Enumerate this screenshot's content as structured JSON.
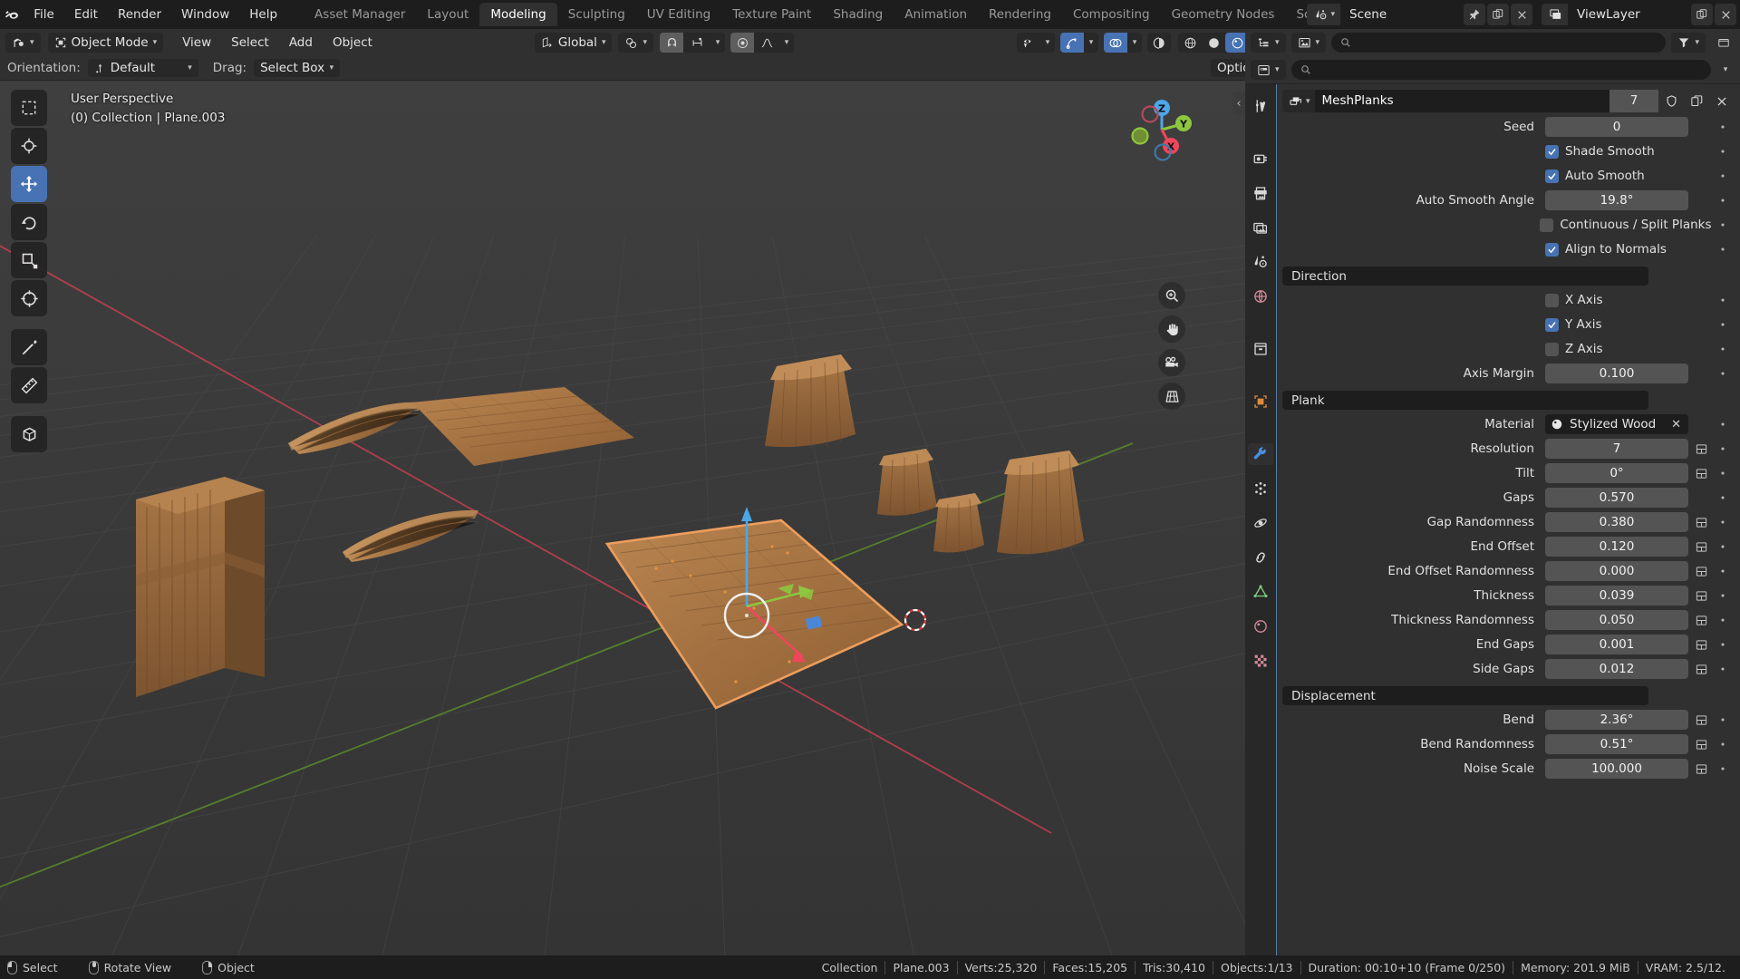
{
  "app": {
    "name": "Blender",
    "logo_icon": "blender-logo-icon"
  },
  "topbar": {
    "menus": [
      "File",
      "Edit",
      "Render",
      "Window",
      "Help"
    ],
    "workspace_tabs": [
      {
        "label": "Asset Manager",
        "active": false
      },
      {
        "label": "Layout",
        "active": false
      },
      {
        "label": "Modeling",
        "active": true
      },
      {
        "label": "Sculpting",
        "active": false
      },
      {
        "label": "UV Editing",
        "active": false
      },
      {
        "label": "Texture Paint",
        "active": false
      },
      {
        "label": "Shading",
        "active": false
      },
      {
        "label": "Animation",
        "active": false
      },
      {
        "label": "Rendering",
        "active": false
      },
      {
        "label": "Compositing",
        "active": false
      },
      {
        "label": "Geometry Nodes",
        "active": false
      },
      {
        "label": "Sc",
        "active": false
      }
    ],
    "scene": {
      "icon": "scene-icon",
      "name": "Scene",
      "pin_icon": "pin-icon",
      "new_icon": "new-scene-icon",
      "delete_icon": "close-icon"
    },
    "viewlayer": {
      "icon": "view-layer-icon",
      "name": "ViewLayer",
      "new_icon": "new-viewlayer-icon",
      "delete_icon": "close-icon"
    }
  },
  "viewport_header": {
    "editor_type_icon": "editor-type-3dview-icon",
    "mode": "Object Mode",
    "mode_icon": "object-mode-icon",
    "menus": [
      "View",
      "Select",
      "Add",
      "Object"
    ],
    "transform_orientation": {
      "label": "Global",
      "icon": "orientation-icon"
    },
    "pivot_icon": "pivot-point-icon",
    "snap_magnet_icon": "snap-magnet-icon",
    "snap_target_icon": "snap-increment-icon",
    "proportional_icon": "proportional-editing-icon",
    "falloff_icon": "falloff-smooth-icon",
    "visibility_icon": "object-visibility-icon",
    "gizmo_icon": "gizmo-icon",
    "overlays_icon": "overlays-icon",
    "xray_icon": "xray-icon",
    "shading_modes": [
      "wireframe",
      "solid",
      "material-preview",
      "rendered"
    ],
    "shading_active": "material-preview"
  },
  "tool_settings": {
    "orientation_label": "Orientation:",
    "orientation_value": "Default",
    "orientation_icon": "orientation-default-icon",
    "drag_label": "Drag:",
    "drag_value": "Select Box",
    "options_label": "Options"
  },
  "viewport": {
    "perspective_label": "User Perspective",
    "object_label": "(0) Collection | Plane.003",
    "gizmo_axes": [
      {
        "axis": "Z",
        "color": "#4ba7e8",
        "label": "Z"
      },
      {
        "axis": "Y",
        "color": "#8dc63f",
        "label": "Y"
      },
      {
        "axis": "X",
        "color": "#f0465c",
        "label": "X"
      }
    ],
    "nav_buttons": [
      "zoom-icon",
      "pan-hand-icon",
      "camera-icon",
      "orthographic-grid-icon"
    ],
    "sidebar_toggle_icon": "chevron-left-icon",
    "tools": [
      {
        "name": "tweak-select-box-tool",
        "icon": "select-box-icon",
        "active": false
      },
      {
        "name": "cursor-tool",
        "icon": "cursor-3d-icon",
        "active": false
      },
      {
        "name": "move-tool",
        "icon": "move-arrows-icon",
        "active": true
      },
      {
        "name": "rotate-tool",
        "icon": "rotate-icon",
        "active": false
      },
      {
        "name": "scale-tool",
        "icon": "scale-icon",
        "active": false
      },
      {
        "name": "transform-tool",
        "icon": "transform-icon",
        "active": false
      },
      {
        "name": "annotate-tool",
        "icon": "pencil-icon",
        "active": false
      },
      {
        "name": "measure-tool",
        "icon": "ruler-icon",
        "active": false
      },
      {
        "name": "add-cube-tool",
        "icon": "add-cube-icon",
        "active": false
      }
    ]
  },
  "properties": {
    "editor_icon": "properties-editor-icon",
    "outliner_icon": "outliner-icon",
    "filter_icon": "filter-icon",
    "search_placeholder": "",
    "tabs": [
      {
        "name": "tool-tab",
        "icon": "tool-wrench-screwdriver-icon",
        "active": false
      },
      {
        "name": "render-tab",
        "icon": "render-camera-back-icon",
        "active": false
      },
      {
        "name": "output-tab",
        "icon": "output-printer-icon",
        "active": false
      },
      {
        "name": "view-layer-tab",
        "icon": "view-layer-images-icon",
        "active": false
      },
      {
        "name": "scene-tab",
        "icon": "scene-cone-sphere-icon",
        "active": false
      },
      {
        "name": "world-tab",
        "icon": "world-globe-icon",
        "active": false
      },
      {
        "name": "collection-tab",
        "icon": "collection-box-icon",
        "active": false
      },
      {
        "name": "object-tab",
        "icon": "object-square-icon",
        "active": false
      },
      {
        "name": "modifier-tab",
        "icon": "modifier-wrench-icon",
        "active": true
      },
      {
        "name": "particles-tab",
        "icon": "particles-icon",
        "active": false
      },
      {
        "name": "physics-tab",
        "icon": "physics-orbit-icon",
        "active": false
      },
      {
        "name": "constraints-tab",
        "icon": "constraints-icon",
        "active": false
      },
      {
        "name": "data-tab",
        "icon": "object-data-triangle-icon",
        "active": false
      },
      {
        "name": "material-tab",
        "icon": "material-sphere-icon",
        "active": false
      },
      {
        "name": "texture-tab",
        "icon": "texture-checker-icon",
        "active": false
      }
    ],
    "modifier": {
      "icon": "geometry-nodes-icon",
      "name": "MeshPlanks",
      "users_count": "7",
      "shield_icon": "shield-fake-user-icon",
      "copy_icon": "duplicate-icon",
      "close_icon": "close-icon"
    },
    "rows": [
      {
        "kind": "value",
        "label": "Seed",
        "value": "0",
        "decorator": false
      },
      {
        "kind": "check",
        "label": "Shade Smooth",
        "checked": true
      },
      {
        "kind": "check",
        "label": "Auto Smooth",
        "checked": true
      },
      {
        "kind": "value",
        "label": "Auto Smooth Angle",
        "value": "19.8°",
        "decorator": false
      },
      {
        "kind": "check",
        "label": "Continuous / Split Planks",
        "checked": false
      },
      {
        "kind": "check",
        "label": "Align to Normals",
        "checked": true
      },
      {
        "kind": "section",
        "label": "Direction"
      },
      {
        "kind": "check",
        "label": "X Axis",
        "checked": false
      },
      {
        "kind": "check",
        "label": "Y Axis",
        "checked": true
      },
      {
        "kind": "check",
        "label": "Z Axis",
        "checked": false
      },
      {
        "kind": "value",
        "label": "Axis Margin",
        "value": "0.100",
        "decorator": false
      },
      {
        "kind": "section",
        "label": "Plank"
      },
      {
        "kind": "material",
        "label": "Material",
        "value": "Stylized Wood",
        "icon": "material-sphere-icon"
      },
      {
        "kind": "value",
        "label": "Resolution",
        "value": "7",
        "decorator": true
      },
      {
        "kind": "value",
        "label": "Tilt",
        "value": "0°",
        "decorator": true
      },
      {
        "kind": "value",
        "label": "Gaps",
        "value": "0.570",
        "decorator": false
      },
      {
        "kind": "value",
        "label": "Gap Randomness",
        "value": "0.380",
        "decorator": true
      },
      {
        "kind": "value",
        "label": "End Offset",
        "value": "0.120",
        "decorator": true
      },
      {
        "kind": "value",
        "label": "End Offset Randomness",
        "value": "0.000",
        "decorator": true
      },
      {
        "kind": "value",
        "label": "Thickness",
        "value": "0.039",
        "decorator": true
      },
      {
        "kind": "value",
        "label": "Thickness Randomness",
        "value": "0.050",
        "decorator": true
      },
      {
        "kind": "value",
        "label": "End Gaps",
        "value": "0.001",
        "decorator": true
      },
      {
        "kind": "value",
        "label": "Side Gaps",
        "value": "0.012",
        "decorator": true
      },
      {
        "kind": "section",
        "label": "Displacement"
      },
      {
        "kind": "value",
        "label": "Bend",
        "value": "2.36°",
        "decorator": true
      },
      {
        "kind": "value",
        "label": "Bend Randomness",
        "value": "0.51°",
        "decorator": true
      },
      {
        "kind": "value",
        "label": "Noise Scale",
        "value": "100.000",
        "decorator": true
      }
    ]
  },
  "statusbar": {
    "hints": [
      {
        "icon": "mouse-left-icon",
        "label": "Select"
      },
      {
        "icon": "mouse-middle-icon",
        "label": "Rotate View"
      },
      {
        "icon": "mouse-right-icon",
        "label": "Object"
      }
    ],
    "stats": [
      "Collection",
      "Plane.003",
      "Verts:25,320",
      "Faces:15,205",
      "Tris:30,410",
      "Objects:1/13",
      "Duration: 00:10+10 (Frame 0/250)",
      "Memory: 201.9 MiB",
      "VRAM: 2.5/12."
    ]
  },
  "colors": {
    "accent_blue": "#4772b3",
    "header_bg": "#303030",
    "panel_bg": "#303030",
    "field_bg": "#545454",
    "dark_bg": "#1d1d1d",
    "viewport_bg": "#3b3b3b",
    "selected_outline": "#ed9e5c",
    "axis_x": "#f0465c",
    "axis_y": "#8dc63f",
    "axis_z": "#4ba7e8",
    "wood": "#a9743f"
  }
}
